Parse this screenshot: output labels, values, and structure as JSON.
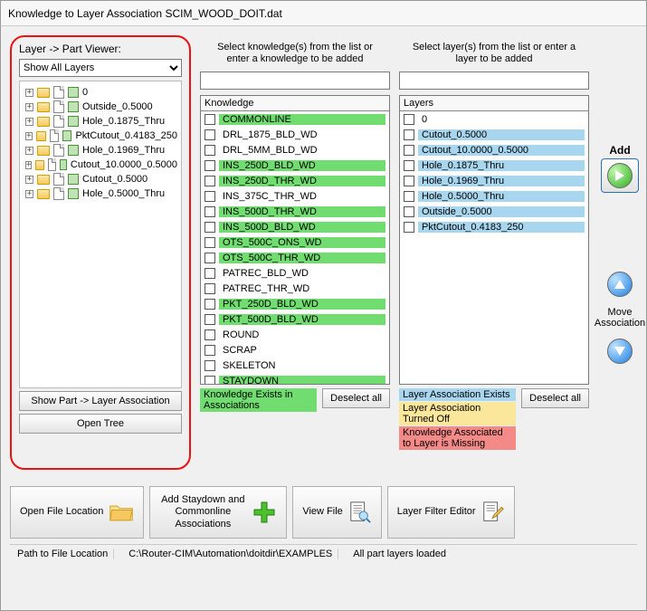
{
  "window": {
    "title": "Knowledge to Layer Association SCIM_WOOD_DOIT.dat"
  },
  "sidebar": {
    "header": "Layer -> Part Viewer:",
    "dropdown_selected": "Show All Layers",
    "tree": [
      {
        "label": "0"
      },
      {
        "label": "Outside_0.5000"
      },
      {
        "label": "Hole_0.1875_Thru"
      },
      {
        "label": "PktCutout_0.4183_250"
      },
      {
        "label": "Hole_0.1969_Thru"
      },
      {
        "label": "Cutout_10.0000_0.5000"
      },
      {
        "label": "Cutout_0.5000"
      },
      {
        "label": "Hole_0.5000_Thru"
      }
    ],
    "btn1": "Show Part -> Layer Association",
    "btn2": "Open Tree"
  },
  "knowledge": {
    "instructions": "Select knowledge(s) from the list or enter a knowledge to be added",
    "header": "Knowledge",
    "items": [
      {
        "label": "COMMONLINE",
        "hl": "green"
      },
      {
        "label": "DRL_1875_BLD_WD",
        "hl": ""
      },
      {
        "label": "DRL_5MM_BLD_WD",
        "hl": ""
      },
      {
        "label": "INS_250D_BLD_WD",
        "hl": "green"
      },
      {
        "label": "INS_250D_THR_WD",
        "hl": "green"
      },
      {
        "label": "INS_375C_THR_WD",
        "hl": ""
      },
      {
        "label": "INS_500D_THR_WD",
        "hl": "green"
      },
      {
        "label": "INS_500D_BLD_WD",
        "hl": "green"
      },
      {
        "label": "OTS_500C_ONS_WD",
        "hl": "green"
      },
      {
        "label": "OTS_500C_THR_WD",
        "hl": "green"
      },
      {
        "label": "PATREC_BLD_WD",
        "hl": ""
      },
      {
        "label": "PATREC_THR_WD",
        "hl": ""
      },
      {
        "label": "PKT_250D_BLD_WD",
        "hl": "green"
      },
      {
        "label": "PKT_500D_BLD_WD",
        "hl": "green"
      },
      {
        "label": "ROUND",
        "hl": ""
      },
      {
        "label": "SCRAP",
        "hl": ""
      },
      {
        "label": "SKELETON",
        "hl": ""
      },
      {
        "label": "STAYDOWN",
        "hl": "green"
      }
    ],
    "legend_exists": "Knowledge Exists in Associations",
    "deselect": "Deselect all"
  },
  "layers": {
    "instructions": "Select layer(s) from the list or enter a layer to be added",
    "header": "Layers",
    "items": [
      {
        "label": "0",
        "hl": ""
      },
      {
        "label": "Cutout_0.5000",
        "hl": "blue"
      },
      {
        "label": "Cutout_10.0000_0.5000",
        "hl": "blue"
      },
      {
        "label": "Hole_0.1875_Thru",
        "hl": "blue"
      },
      {
        "label": "Hole_0.1969_Thru",
        "hl": "blue"
      },
      {
        "label": "Hole_0.5000_Thru",
        "hl": "blue"
      },
      {
        "label": "Outside_0.5000",
        "hl": "blue"
      },
      {
        "label": "PktCutout_0.4183_250",
        "hl": "blue"
      }
    ],
    "legend_exists": "Layer Association Exists",
    "legend_off": "Layer Association Turned Off",
    "legend_missing": "Knowledge Associated to Layer is Missing",
    "deselect": "Deselect all"
  },
  "side": {
    "add": "Add",
    "move": "Move Association"
  },
  "toolbar": {
    "open_loc": "Open File Location",
    "add_staydown": "Add Staydown and Commonline Associations",
    "view_file": "View File",
    "layer_filter": "Layer Filter Editor"
  },
  "status": {
    "lbl": "Path to File Location",
    "path": "C:\\Router-CIM\\Automation\\doitdir\\EXAMPLES",
    "msg": "All part layers loaded"
  }
}
